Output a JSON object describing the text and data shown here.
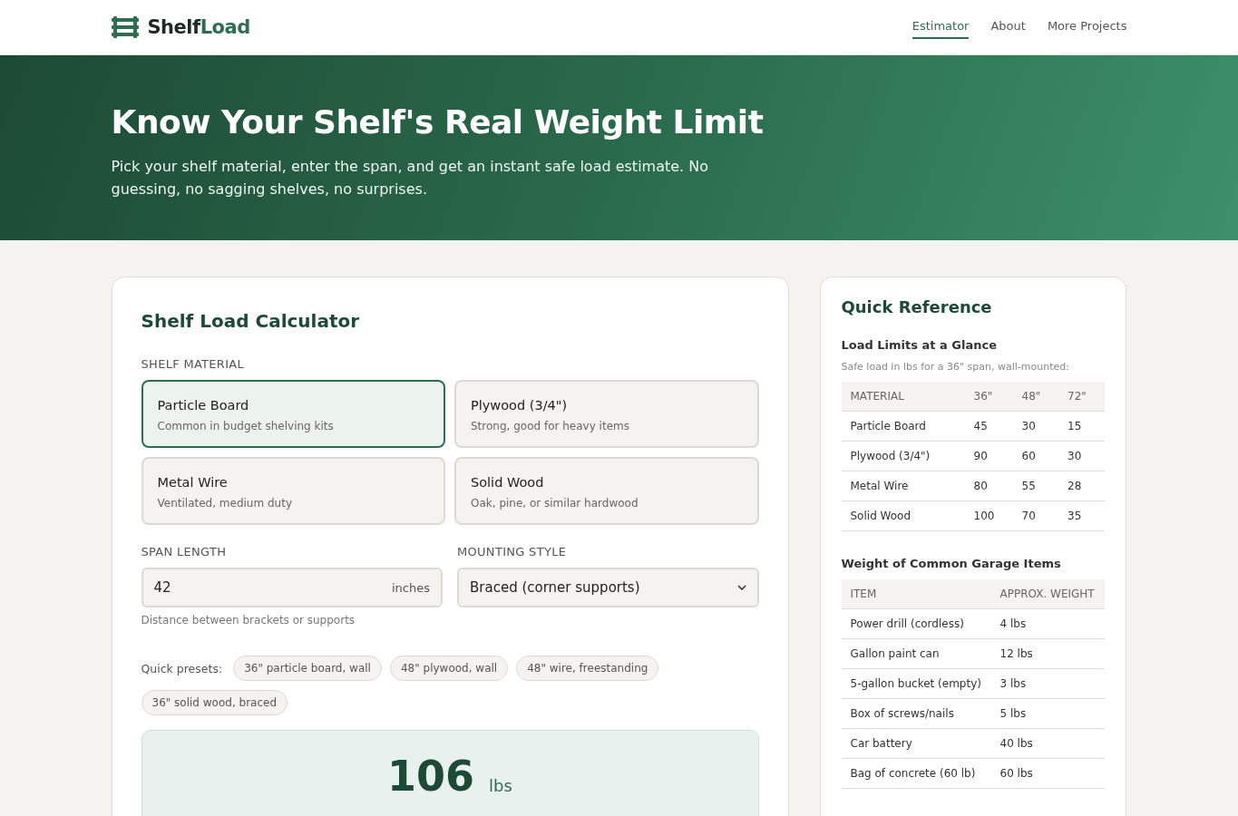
{
  "brand": {
    "part_1": "Shelf",
    "part_2": "Load"
  },
  "nav": [
    {
      "label": "Estimator",
      "selected": true
    },
    {
      "label": "About",
      "selected": false
    },
    {
      "label": "More Projects",
      "selected": false
    }
  ],
  "hero": {
    "title": "Know Your Shelf's Real Weight Limit",
    "subtitle": "Pick your shelf material, enter the span, and get an instant safe load estimate. No guessing, no sagging shelves, no surprises."
  },
  "calculator": {
    "title": "Shelf Load Calculator",
    "material_label": "SHELF MATERIAL",
    "materials": [
      {
        "name": "Particle Board",
        "description": "Common in budget shelving kits",
        "selected": true
      },
      {
        "name": "Plywood (3/4\")",
        "description": "Strong, good for heavy items",
        "selected": false
      },
      {
        "name": "Metal Wire",
        "description": "Ventilated, medium duty",
        "selected": false
      },
      {
        "name": "Solid Wood",
        "description": "Oak, pine, or similar hardwood",
        "selected": false
      }
    ],
    "span": {
      "label": "SPAN LENGTH",
      "value": "42",
      "unit": "inches",
      "hint": "Distance between brackets or supports"
    },
    "mounting": {
      "label": "MOUNTING STYLE",
      "value": "Braced (corner supports)"
    },
    "presets_label": "Quick presets:",
    "presets": [
      "36\" particle board, wall",
      "48\" plywood, wall",
      "48\" wire, freestanding",
      "36\" solid wood, braced"
    ],
    "result": {
      "value": "106",
      "unit": "lbs"
    }
  },
  "reference": {
    "title": "Quick Reference",
    "limits": {
      "title": "Load Limits at a Glance",
      "note": "Safe load in lbs for a 36\" span, wall-mounted:",
      "columns": [
        "MATERIAL",
        "36\"",
        "48\"",
        "72\""
      ],
      "rows": [
        [
          "Particle Board",
          "45",
          "30",
          "15"
        ],
        [
          "Plywood (3/4\")",
          "90",
          "60",
          "30"
        ],
        [
          "Metal Wire",
          "80",
          "55",
          "28"
        ],
        [
          "Solid Wood",
          "100",
          "70",
          "35"
        ]
      ]
    },
    "items": {
      "title": "Weight of Common Garage Items",
      "columns": [
        "ITEM",
        "APPROX. WEIGHT"
      ],
      "rows": [
        [
          "Power drill (cordless)",
          "4 lbs"
        ],
        [
          "Gallon paint can",
          "12 lbs"
        ],
        [
          "5-gallon bucket (empty)",
          "3 lbs"
        ],
        [
          "Box of screws/nails",
          "5 lbs"
        ],
        [
          "Car battery",
          "40 lbs"
        ],
        [
          "Bag of concrete (60 lb)",
          "60 lbs"
        ]
      ]
    }
  }
}
